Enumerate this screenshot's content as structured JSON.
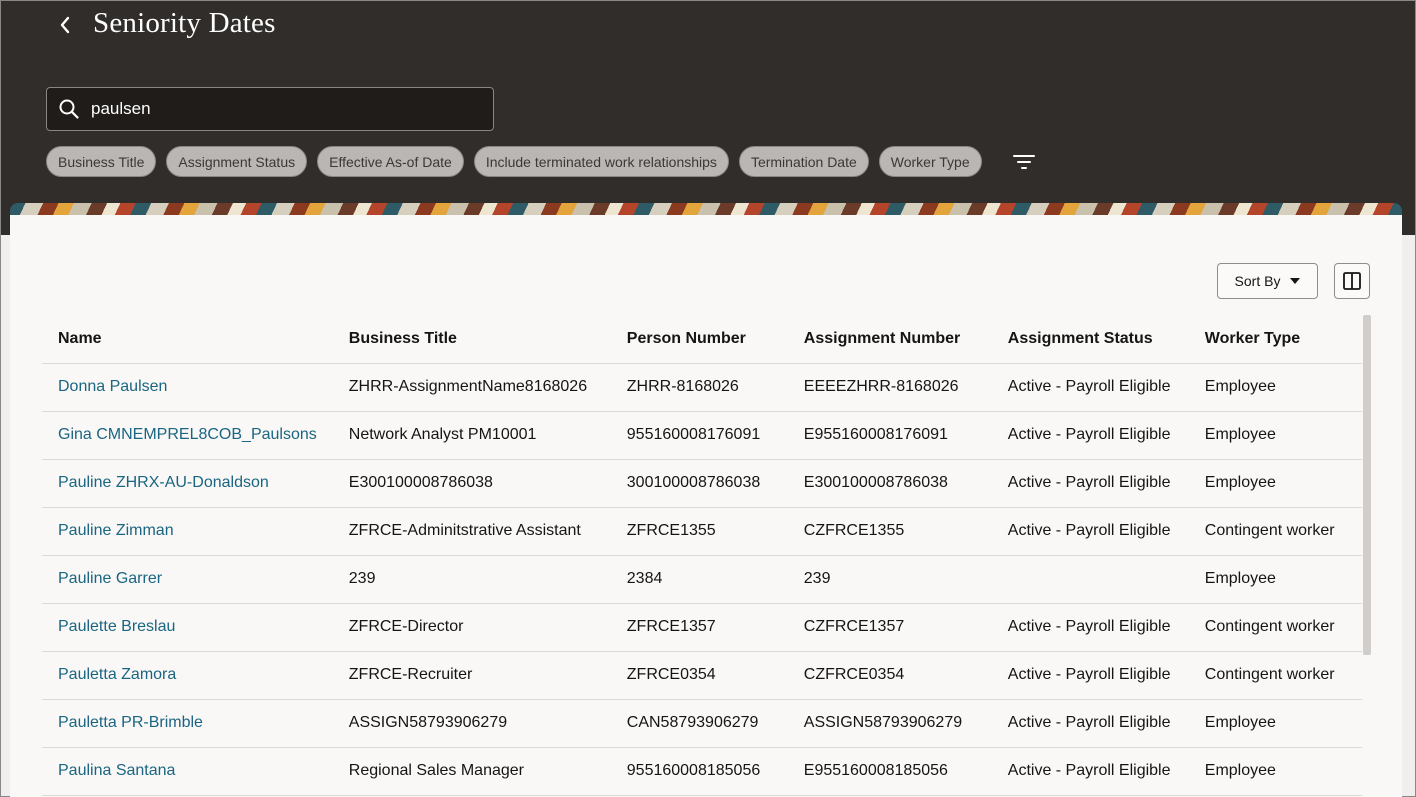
{
  "header": {
    "title": "Seniority Dates",
    "search_value": "paulsen"
  },
  "filters": {
    "chips": [
      "Business Title",
      "Assignment Status",
      "Effective As-of Date",
      "Include terminated work relationships",
      "Termination Date",
      "Worker Type"
    ]
  },
  "toolbar": {
    "sort_label": "Sort By"
  },
  "table": {
    "columns": [
      "Name",
      "Business Title",
      "Person Number",
      "Assignment Number",
      "Assignment Status",
      "Worker Type"
    ],
    "rows": [
      [
        "Donna Paulsen",
        "ZHRR-AssignmentName8168026",
        "ZHRR-8168026",
        "EEEEZHRR-8168026",
        "Active - Payroll Eligible",
        "Employee"
      ],
      [
        "Gina CMNEMPREL8COB_Paulsons",
        "Network Analyst PM10001",
        "955160008176091",
        "E955160008176091",
        "Active - Payroll Eligible",
        "Employee"
      ],
      [
        "Pauline ZHRX-AU-Donaldson",
        "E300100008786038",
        "300100008786038",
        "E300100008786038",
        "Active - Payroll Eligible",
        "Employee"
      ],
      [
        "Pauline Zimman",
        "ZFRCE-Adminitstrative Assistant",
        "ZFRCE1355",
        "CZFRCE1355",
        "Active - Payroll Eligible",
        "Contingent worker"
      ],
      [
        "Pauline Garrer",
        "239",
        "2384",
        "239",
        "",
        "Employee"
      ],
      [
        "Paulette Breslau",
        "ZFRCE-Director",
        "ZFRCE1357",
        "CZFRCE1357",
        "Active - Payroll Eligible",
        "Contingent worker"
      ],
      [
        "Pauletta Zamora",
        "ZFRCE-Recruiter",
        "ZFRCE0354",
        "CZFRCE0354",
        "Active - Payroll Eligible",
        "Contingent worker"
      ],
      [
        "Pauletta PR-Brimble",
        "ASSIGN58793906279",
        "CAN58793906279",
        "ASSIGN58793906279",
        "Active - Payroll Eligible",
        "Employee"
      ],
      [
        "Paulina Santana",
        "Regional Sales Manager",
        "955160008185056",
        "E955160008185056",
        "Active - Payroll Eligible",
        "Employee"
      ]
    ]
  },
  "colors": {
    "header_bg": "#312d2a",
    "link": "#1a6582",
    "chip_bg": "#b9b6b3"
  },
  "icons": [
    "back-chevron-icon",
    "search-icon",
    "filter-icon",
    "caret-down-icon",
    "panel-split-icon"
  ]
}
